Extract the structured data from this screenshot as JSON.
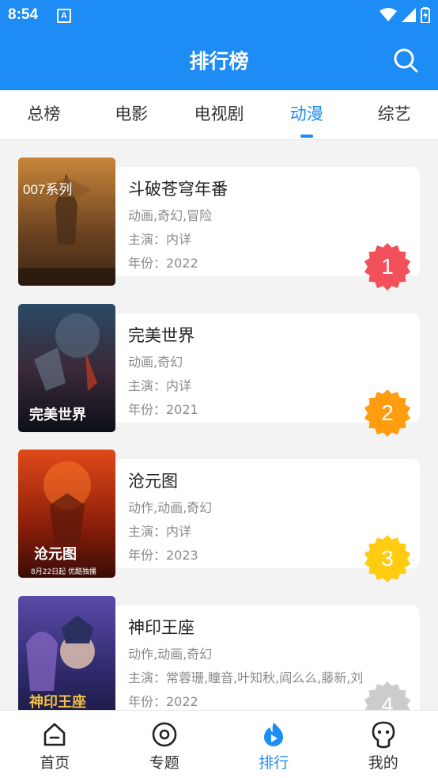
{
  "status_bar": {
    "time": "8:54",
    "notif_letter": "A"
  },
  "app_bar": {
    "title": "排行榜"
  },
  "tabs": [
    {
      "label": "总榜",
      "active": false
    },
    {
      "label": "电影",
      "active": false
    },
    {
      "label": "电视剧",
      "active": false
    },
    {
      "label": "动漫",
      "active": true
    },
    {
      "label": "综艺",
      "active": false
    }
  ],
  "items": [
    {
      "title": "斗破苍穹年番",
      "genre": "动画,奇幻,冒险",
      "cast": "主演：内详",
      "year": "年份：2022",
      "rank": "1",
      "rank_color": "#f2505a",
      "poster_text": "007系列",
      "poster_colors": [
        "#c8863a",
        "#3b2616"
      ]
    },
    {
      "title": "完美世界",
      "genre": "动画,奇幻",
      "cast": "主演：内详",
      "year": "年份：2021",
      "rank": "2",
      "rank_color": "#ff9c0f",
      "poster_text": "完美世界",
      "poster_colors": [
        "#2a4a66",
        "#0e1018"
      ]
    },
    {
      "title": "沧元图",
      "genre": "动作,动画,奇幻",
      "cast": "主演：内详",
      "year": "年份：2023",
      "rank": "3",
      "rank_color": "#ffcc12",
      "poster_text": "沧元图",
      "poster_sub": "8月22日起 优酷独播",
      "poster_colors": [
        "#e04a18",
        "#3a0c06"
      ]
    },
    {
      "title": "神印王座",
      "genre": "动作,动画,奇幻",
      "cast": "主演：常蓉珊,瞳音,叶知秋,阎么么,藤新,刘",
      "year": "年份：2022",
      "rank": "4",
      "rank_color": "#cccccc",
      "poster_text": "神印王座",
      "poster_colors": [
        "#5a4aa8",
        "#1a1840"
      ]
    }
  ],
  "bottom_nav": [
    {
      "label": "首页",
      "icon": "home-icon",
      "active": false
    },
    {
      "label": "专题",
      "icon": "topic-icon",
      "active": false
    },
    {
      "label": "排行",
      "icon": "ranking-icon",
      "active": true
    },
    {
      "label": "我的",
      "icon": "profile-icon",
      "active": false
    }
  ],
  "colors": {
    "primary": "#1e8cf5"
  }
}
